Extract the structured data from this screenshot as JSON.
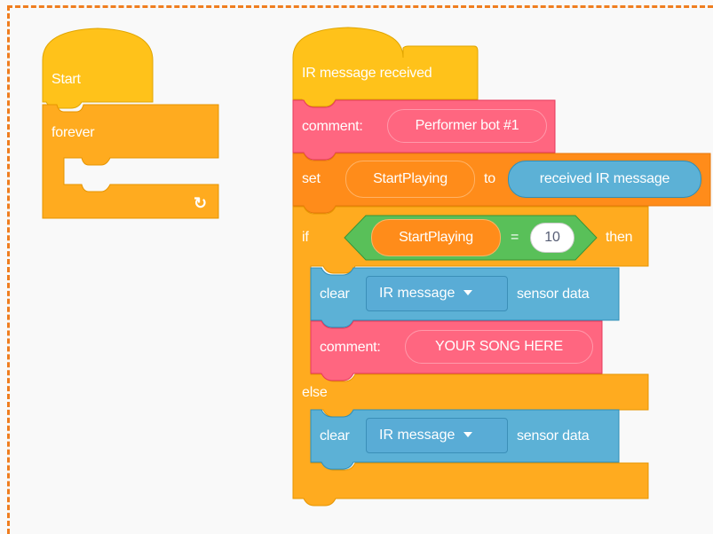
{
  "left_script": {
    "start_label": "Start",
    "forever_label": "forever",
    "loop_arrow_icon": "↻"
  },
  "main_script": {
    "hat_label": "IR message received",
    "comment1": {
      "prefix": "comment:",
      "text": "Performer bot #1"
    },
    "set": {
      "keyword": "set",
      "variable": "StartPlaying",
      "to": "to",
      "value": "received IR message"
    },
    "if": {
      "keyword": "if",
      "variable": "StartPlaying",
      "operator": "=",
      "number": "10",
      "then": "then"
    },
    "clear1": {
      "keyword": "clear",
      "sensor": "IR message",
      "suffix": "sensor data"
    },
    "comment2": {
      "prefix": "comment:",
      "text": "YOUR SONG HERE"
    },
    "else_label": "else",
    "clear2": {
      "keyword": "clear",
      "sensor": "IR message",
      "suffix": "sensor data"
    }
  },
  "colors": {
    "event_yellow": "#ffc21a",
    "control_orange": "#ffab1f",
    "variable_orange": "#ff8c1a",
    "comment_pink": "#ff6680",
    "operator_green": "#59c059",
    "sensor_blue": "#5cb1d6",
    "border_dashed": "#ef7d1f"
  }
}
